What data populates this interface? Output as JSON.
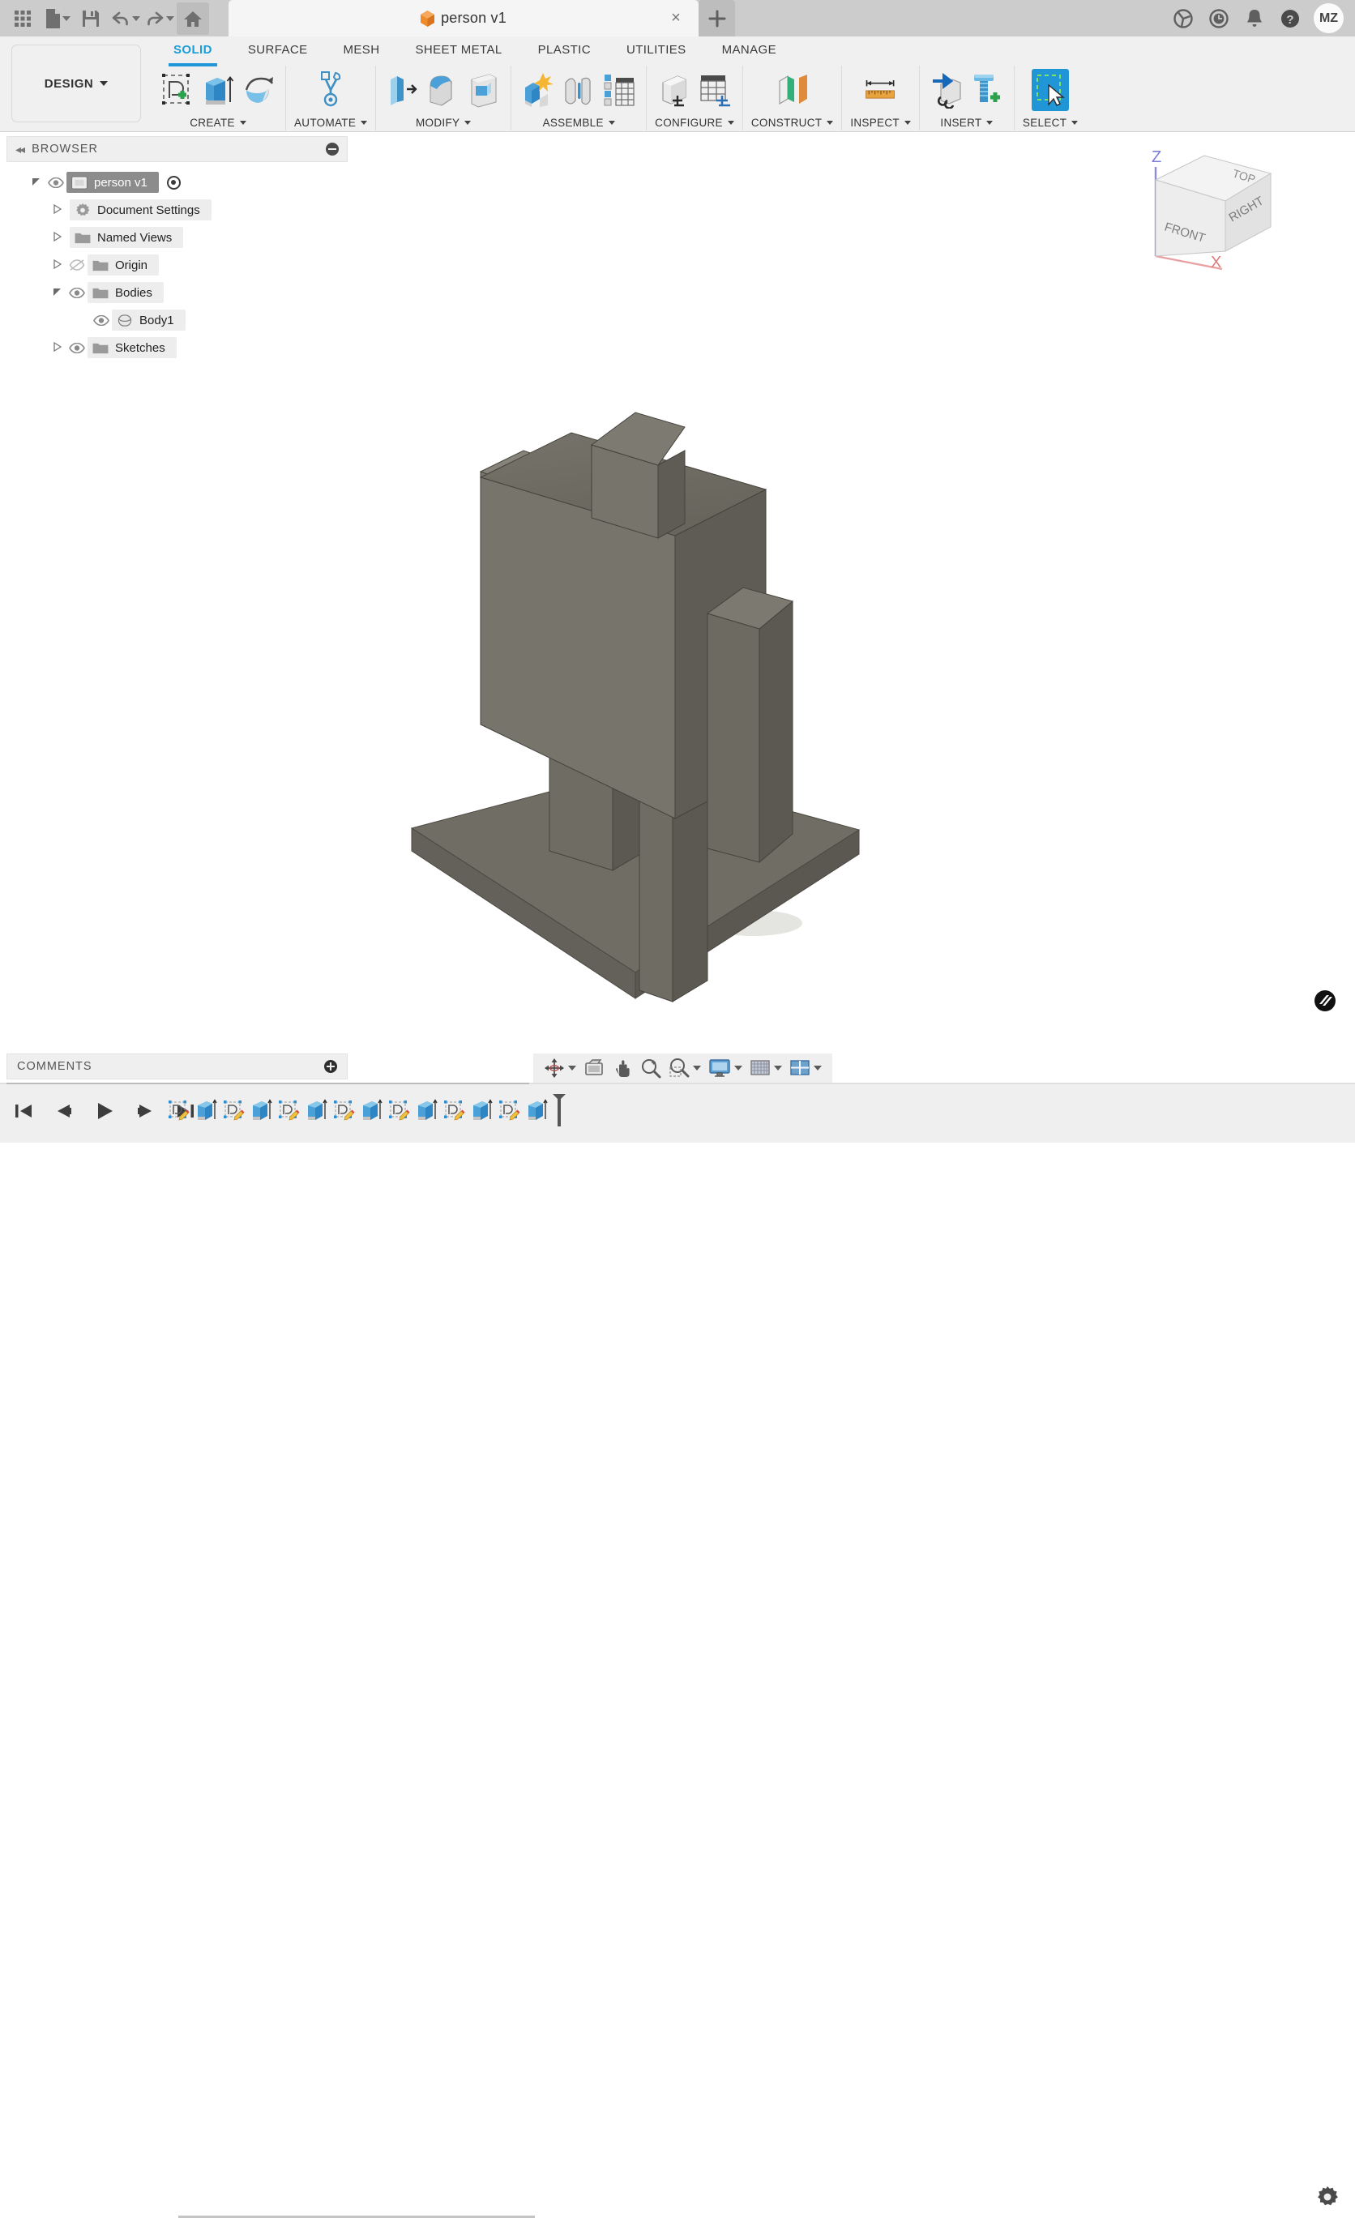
{
  "app": {
    "document_title": "person v1",
    "user_initials": "MZ"
  },
  "quick_access": {
    "items": [
      {
        "name": "app-grid-icon",
        "label": "Show Data Panel"
      },
      {
        "name": "new-file-icon",
        "label": "File"
      },
      {
        "name": "save-icon",
        "label": "Save"
      },
      {
        "name": "undo-icon",
        "label": "Undo"
      },
      {
        "name": "redo-icon",
        "label": "Redo"
      },
      {
        "name": "home-icon",
        "label": "Home"
      }
    ]
  },
  "title_actions": {
    "close_label": "×",
    "new_tab_label": "+",
    "icons": [
      {
        "name": "extensions-icon",
        "label": "Extensions"
      },
      {
        "name": "job-status-icon",
        "label": "Job Status"
      },
      {
        "name": "notifications-icon",
        "label": "Notifications"
      },
      {
        "name": "help-icon",
        "label": "Help"
      }
    ]
  },
  "ribbon": {
    "workspace_label": "DESIGN",
    "tabs": [
      {
        "label": "SOLID",
        "selected": true
      },
      {
        "label": "SURFACE",
        "selected": false
      },
      {
        "label": "MESH",
        "selected": false
      },
      {
        "label": "SHEET METAL",
        "selected": false
      },
      {
        "label": "PLASTIC",
        "selected": false
      },
      {
        "label": "UTILITIES",
        "selected": false
      },
      {
        "label": "MANAGE",
        "selected": false
      }
    ],
    "groups": [
      {
        "label": "CREATE",
        "icons": [
          "sketch-create-icon",
          "extrude-icon",
          "revolve-icon"
        ]
      },
      {
        "label": "AUTOMATE",
        "icons": [
          "automate-icon"
        ]
      },
      {
        "label": "MODIFY",
        "icons": [
          "press-pull-icon",
          "fillet-icon",
          "shell-icon"
        ]
      },
      {
        "label": "ASSEMBLE",
        "icons": [
          "new-component-icon",
          "joint-icon",
          "table-icon"
        ]
      },
      {
        "label": "CONFIGURE",
        "icons": [
          "configure-part-icon",
          "configure-table-icon"
        ]
      },
      {
        "label": "CONSTRUCT",
        "icons": [
          "offset-plane-icon"
        ]
      },
      {
        "label": "INSPECT",
        "icons": [
          "measure-icon"
        ]
      },
      {
        "label": "INSERT",
        "icons": [
          "insert-derive-icon",
          "insert-mcmaster-icon"
        ]
      },
      {
        "label": "SELECT",
        "icons": [
          "select-window-icon"
        ]
      }
    ]
  },
  "browser": {
    "title": "BROWSER",
    "collapse_label": "◂◂",
    "tree": [
      {
        "label": "person v1",
        "indent": 0,
        "arrow": "down",
        "eye": true,
        "icon": "component-icon",
        "selected": true,
        "radio": true
      },
      {
        "label": "Document Settings",
        "indent": 1,
        "arrow": "right",
        "eye": false,
        "icon": "gear-icon",
        "selected": false,
        "radio": false
      },
      {
        "label": "Named Views",
        "indent": 1,
        "arrow": "right",
        "eye": false,
        "icon": "folder-icon",
        "selected": false,
        "radio": false
      },
      {
        "label": "Origin",
        "indent": 1,
        "arrow": "right",
        "eye": "hidden",
        "icon": "folder-icon",
        "selected": false,
        "radio": false
      },
      {
        "label": "Bodies",
        "indent": 1,
        "arrow": "down",
        "eye": true,
        "icon": "folder-icon",
        "selected": false,
        "radio": false
      },
      {
        "label": "Body1",
        "indent": 2,
        "arrow": "none",
        "eye": true,
        "icon": "body-icon",
        "selected": false,
        "radio": false
      },
      {
        "label": "Sketches",
        "indent": 1,
        "arrow": "right",
        "eye": true,
        "icon": "folder-icon",
        "selected": false,
        "radio": false
      }
    ]
  },
  "viewcube": {
    "axis_z": "Z",
    "axis_x": "X",
    "faces": {
      "top": "TOP",
      "front": "FRONT",
      "right": "RIGHT"
    }
  },
  "model": {
    "body_color": "#6e6c63",
    "body_color_light": "#7b7970",
    "body_color_dark": "#56544d",
    "description": "Blocky person figure: head, torso, two arms, two legs on a base plate"
  },
  "comments": {
    "title": "COMMENTS"
  },
  "navbar": {
    "items": [
      {
        "name": "orbit-icon",
        "label": "Orbit",
        "caret": true
      },
      {
        "name": "look-at-icon",
        "label": "Look At",
        "caret": false
      },
      {
        "name": "pan-icon",
        "label": "Pan",
        "caret": false
      },
      {
        "name": "zoom-icon",
        "label": "Zoom",
        "caret": false
      },
      {
        "name": "zoom-window-icon",
        "label": "Fit",
        "caret": true
      },
      {
        "name": "display-settings-icon",
        "label": "Display Settings",
        "caret": true
      },
      {
        "name": "grid-snaps-icon",
        "label": "Grid and Snaps",
        "caret": true
      },
      {
        "name": "viewports-icon",
        "label": "Viewports",
        "caret": true
      }
    ]
  },
  "timeline": {
    "playback": [
      {
        "name": "go-to-beginning-icon",
        "label": "Go to beginning"
      },
      {
        "name": "step-back-icon",
        "label": "Step back"
      },
      {
        "name": "play-back-icon",
        "label": "Play"
      },
      {
        "name": "step-forward-icon",
        "label": "Step forward"
      },
      {
        "name": "go-to-end-icon",
        "label": "Go to end"
      }
    ],
    "features": [
      {
        "type": "sketch",
        "label": "Sketch1"
      },
      {
        "type": "extrude",
        "label": "Extrude1"
      },
      {
        "type": "sketch",
        "label": "Sketch2"
      },
      {
        "type": "extrude",
        "label": "Extrude2"
      },
      {
        "type": "sketch",
        "label": "Sketch3"
      },
      {
        "type": "extrude",
        "label": "Extrude3"
      },
      {
        "type": "sketch",
        "label": "Sketch4"
      },
      {
        "type": "extrude",
        "label": "Extrude4"
      },
      {
        "type": "sketch",
        "label": "Sketch5"
      },
      {
        "type": "extrude",
        "label": "Extrude5"
      },
      {
        "type": "sketch",
        "label": "Sketch6"
      },
      {
        "type": "extrude",
        "label": "Extrude6"
      },
      {
        "type": "sketch",
        "label": "Sketch7"
      },
      {
        "type": "extrude",
        "label": "Extrude7"
      }
    ],
    "settings_label": "Timeline settings"
  }
}
